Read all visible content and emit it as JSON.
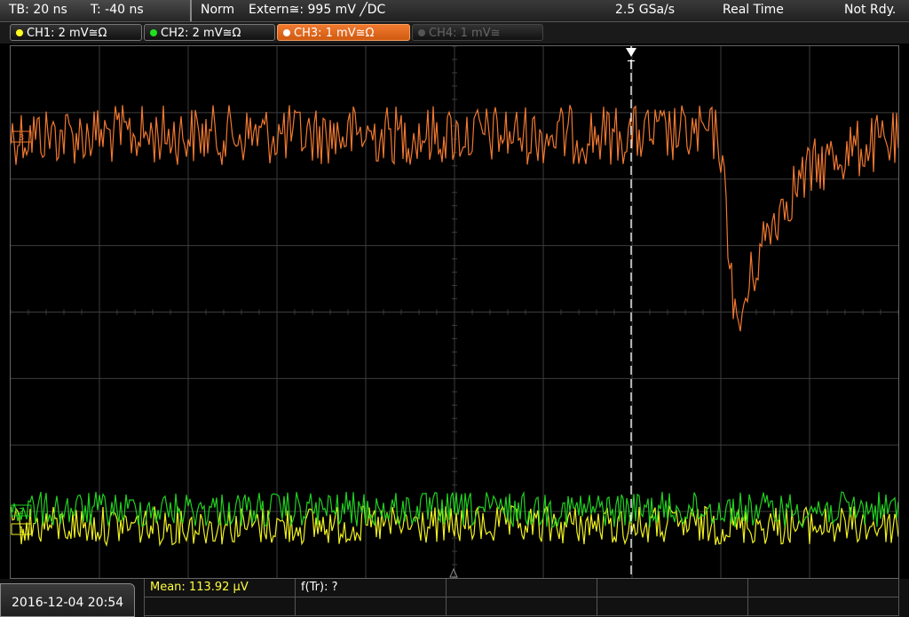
{
  "topbar": {
    "timebase": "TB: 20 ns",
    "trigger_pos": "T: -40 ns",
    "mode": "Norm",
    "trigger_source": "Extern≅: 995 mV ╱DC",
    "sample_rate": "2.5 GSa/s",
    "acq_mode": "Real Time",
    "status": "Not Rdy."
  },
  "channels": [
    {
      "label": "CH1: 2 mV≅Ω",
      "color": "#ffff20",
      "state": "on"
    },
    {
      "label": "CH2: 2 mV≅Ω",
      "color": "#20e020",
      "state": "on"
    },
    {
      "label": "CH3: 1 mV≅Ω",
      "color": "#ff8030",
      "state": "active"
    },
    {
      "label": "CH4: 1 mV≅",
      "color": "#555555",
      "state": "off"
    }
  ],
  "plot": {
    "markers": {
      "trigger": "T",
      "ch1": "1",
      "ch2": "2",
      "ch3": "3"
    }
  },
  "bottombar": {
    "datetime": "2016-12-04 20:54",
    "measurements": [
      {
        "label": "Mean: 113.92 µV",
        "color": "#ffff40"
      },
      {
        "label": "f(Tr): ?",
        "color": "#ffffff"
      }
    ]
  },
  "colors": {
    "ch1": "#f0f020",
    "ch2": "#20d020",
    "ch3": "#f07830",
    "grid": "#3c3c3c",
    "trigger_line": "#ffffff"
  }
}
